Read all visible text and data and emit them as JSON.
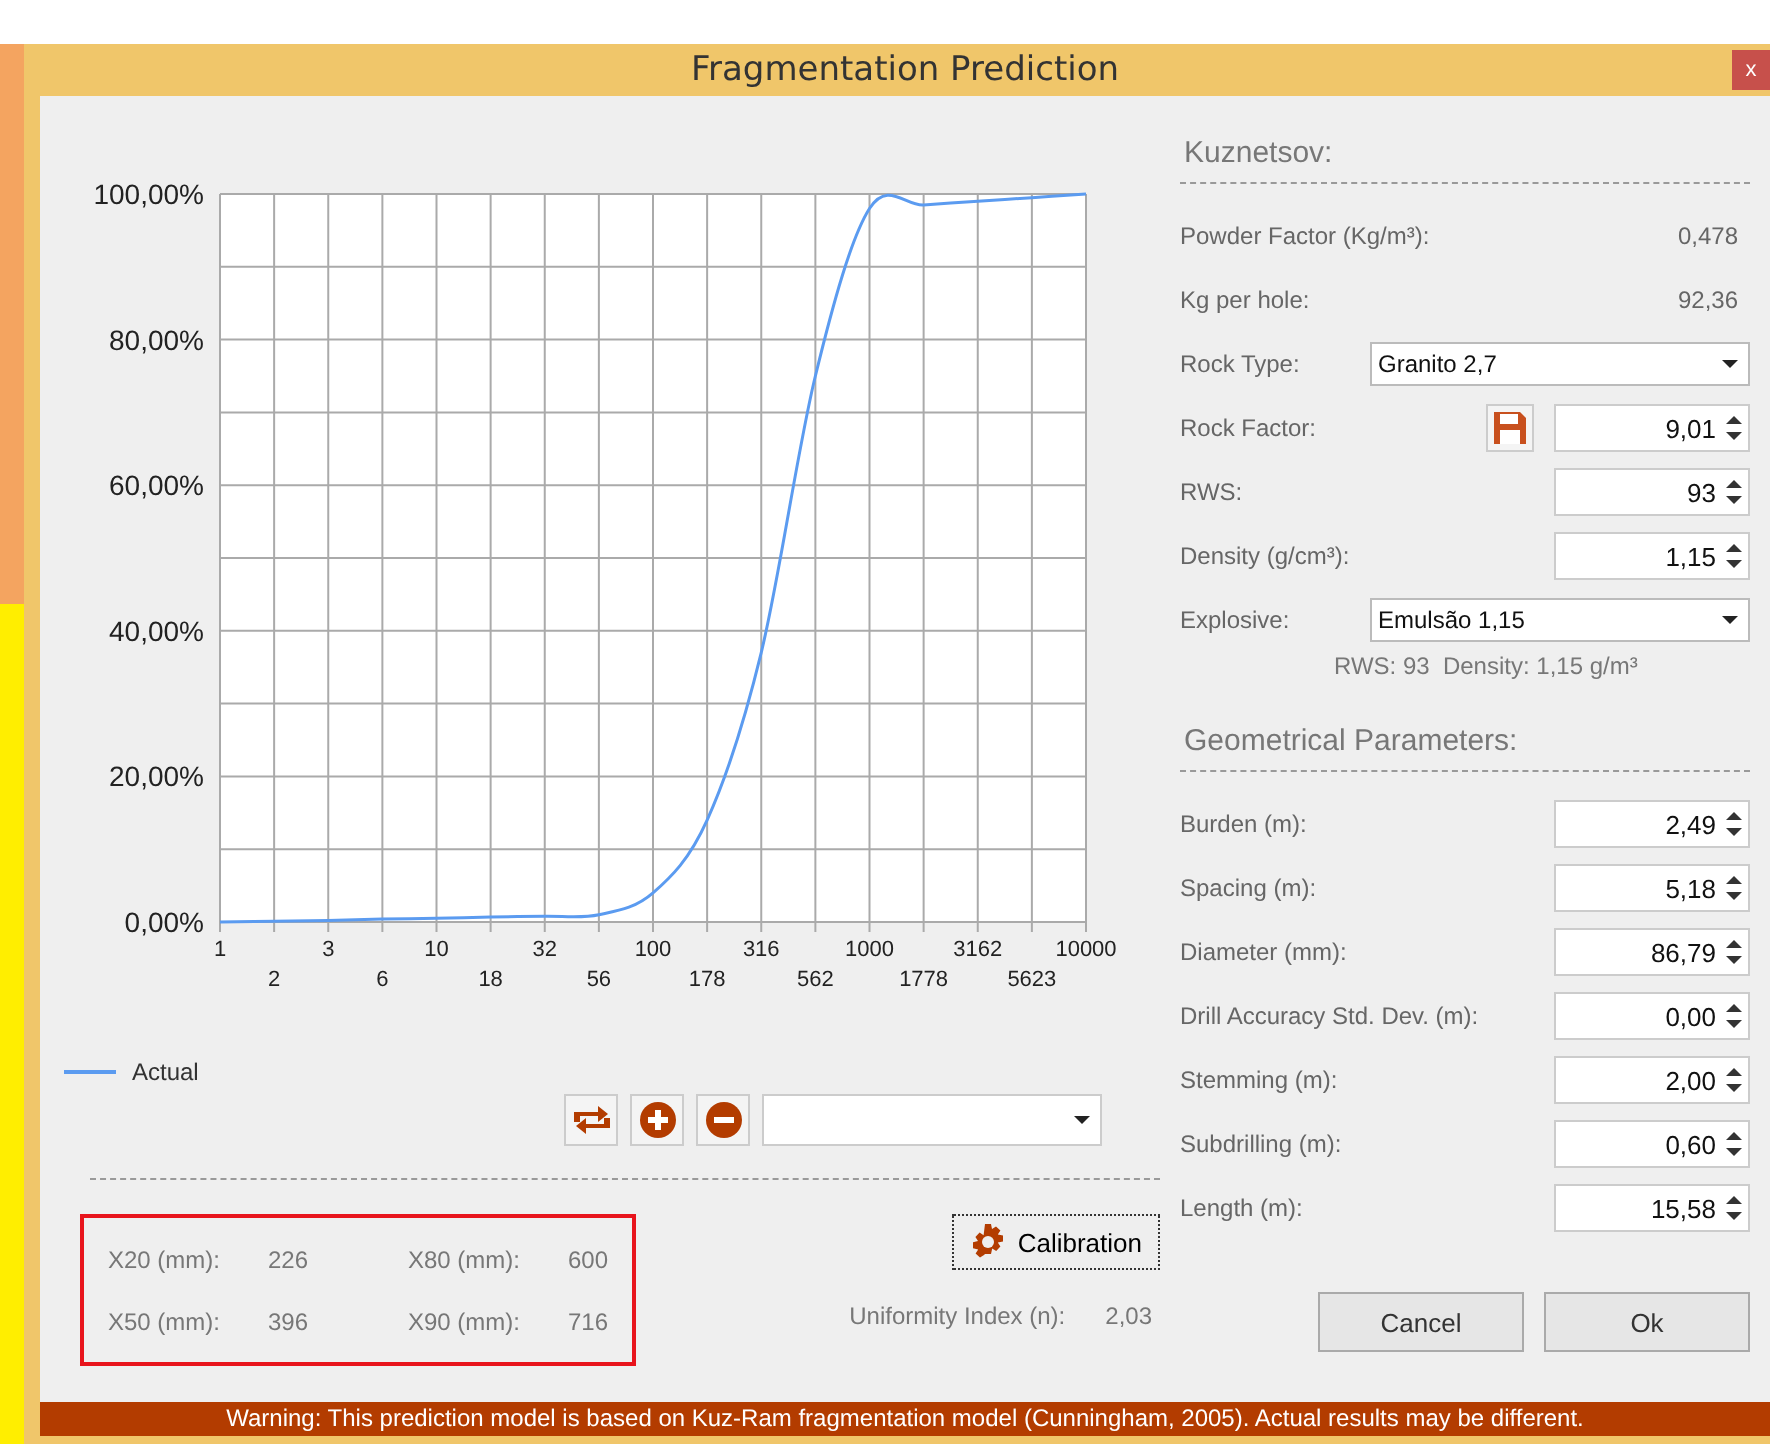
{
  "window": {
    "title": "Fragmentation Prediction",
    "close": "x"
  },
  "chart": {
    "chart_data": {
      "type": "line",
      "categories": [
        "1",
        "2",
        "3",
        "6",
        "10",
        "18",
        "32",
        "56",
        "100",
        "178",
        "316",
        "562",
        "1000",
        "1778",
        "3162",
        "5623",
        "10000"
      ],
      "series": [
        {
          "name": "Actual",
          "color": "#5b9bf0",
          "values": [
            0,
            0.1,
            0.2,
            0.4,
            0.5,
            0.7,
            0.8,
            1,
            4,
            14,
            37,
            75,
            98,
            98.5,
            99,
            99.5,
            100
          ]
        }
      ],
      "grid": true,
      "ylim": [
        0,
        100
      ],
      "yticks": [
        {
          "value": 0,
          "label": "0,00%"
        },
        {
          "value": 20,
          "label": "20,00%"
        },
        {
          "value": 40,
          "label": "40,00%"
        },
        {
          "value": 60,
          "label": "60,00%"
        },
        {
          "value": 80,
          "label": "80,00%"
        },
        {
          "value": 100,
          "label": "100,00%"
        }
      ]
    }
  },
  "results": [
    {
      "label": "X20 (mm):",
      "value": "226"
    },
    {
      "label": "X80 (mm):",
      "value": "600"
    },
    {
      "label": "X50 (mm):",
      "value": "396"
    },
    {
      "label": "X90 (mm):",
      "value": "716"
    }
  ],
  "calibration_button": "Calibration",
  "uniformity": {
    "label": "Uniformity Index (n):",
    "value": "2,03"
  },
  "kuznetsov": {
    "heading": "Kuznetsov:",
    "rows": [
      {
        "kind": "readout",
        "label": "Powder Factor (Kg/m³):",
        "value": "0,478"
      },
      {
        "kind": "readout",
        "label": "Kg per hole:",
        "value": "92,36"
      },
      {
        "kind": "combo",
        "label": "Rock Type:",
        "value": "Granito 2,7"
      },
      {
        "kind": "spinner",
        "label": "Rock Factor:",
        "value": "9,01",
        "save": true
      },
      {
        "kind": "spinner",
        "label": "RWS:",
        "value": "93",
        "save": false
      },
      {
        "kind": "spinner",
        "label": "Density (g/cm³):",
        "value": "1,15",
        "save": false
      },
      {
        "kind": "combo",
        "label": "Explosive:",
        "value": "Emulsão 1,15"
      }
    ],
    "note": "RWS: 93  Density: 1,15 g/m³"
  },
  "geometry": {
    "heading": "Geometrical Parameters:",
    "rows": [
      {
        "label": "Burden (m):",
        "value": "2,49"
      },
      {
        "label": "Spacing (m):",
        "value": "5,18"
      },
      {
        "label": "Diameter (mm):",
        "value": "86,79"
      },
      {
        "label": "Drill Accuracy Std. Dev. (m):",
        "value": "0,00"
      },
      {
        "label": "Stemming (m):",
        "value": "2,00"
      },
      {
        "label": "Subdrilling (m):",
        "value": "0,60"
      },
      {
        "label": "Length (m):",
        "value": "15,58"
      }
    ]
  },
  "buttons": [
    "Cancel",
    "Ok"
  ],
  "warning": "Warning: This prediction model is based on Kuz-Ram fragmentation model (Cunningham, 2005). Actual results may be different."
}
